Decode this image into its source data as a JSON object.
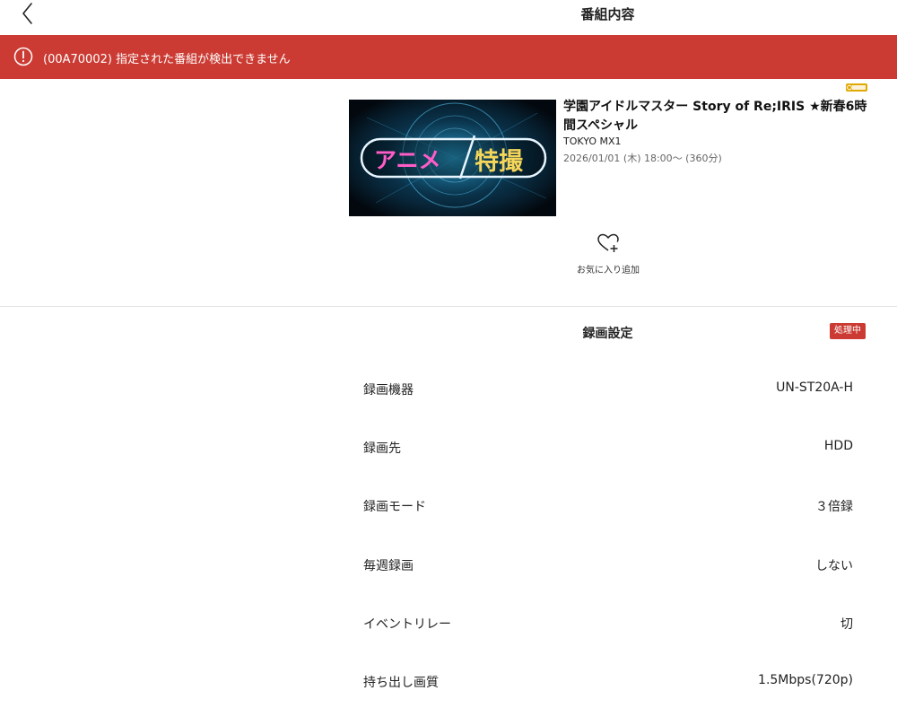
{
  "header": {
    "title": "番組内容"
  },
  "error": {
    "message": "(00A70002) 指定された番組が検出できません"
  },
  "program": {
    "title": "学園アイドルマスター Story of Re;IRIS ★新春6時間スペシャル",
    "channel": "TOKYO MX1",
    "datetime": "2026/01/01 (木) 18:00～ (360分)",
    "thumbnail_text_left": "アニメ",
    "thumbnail_text_right": "特撮",
    "favorite_label": "お気に入り追加"
  },
  "recording": {
    "section_title": "録画設定",
    "status_badge": "処理中",
    "rows": [
      {
        "label": "録画機器",
        "value": "UN-ST20A-H"
      },
      {
        "label": "録画先",
        "value": "HDD"
      },
      {
        "label": "録画モード",
        "value": "３倍録"
      },
      {
        "label": "毎週録画",
        "value": "しない"
      },
      {
        "label": "イベントリレー",
        "value": "切"
      },
      {
        "label": "持ち出し画質",
        "value": "1.5Mbps(720p)"
      }
    ]
  },
  "colors": {
    "accent_red": "#cb3b33",
    "gold": "#e0a800"
  },
  "icons": {
    "back": "chevron-left-icon",
    "error": "exclamation-circle-icon",
    "favorite": "heart-plus-icon"
  }
}
